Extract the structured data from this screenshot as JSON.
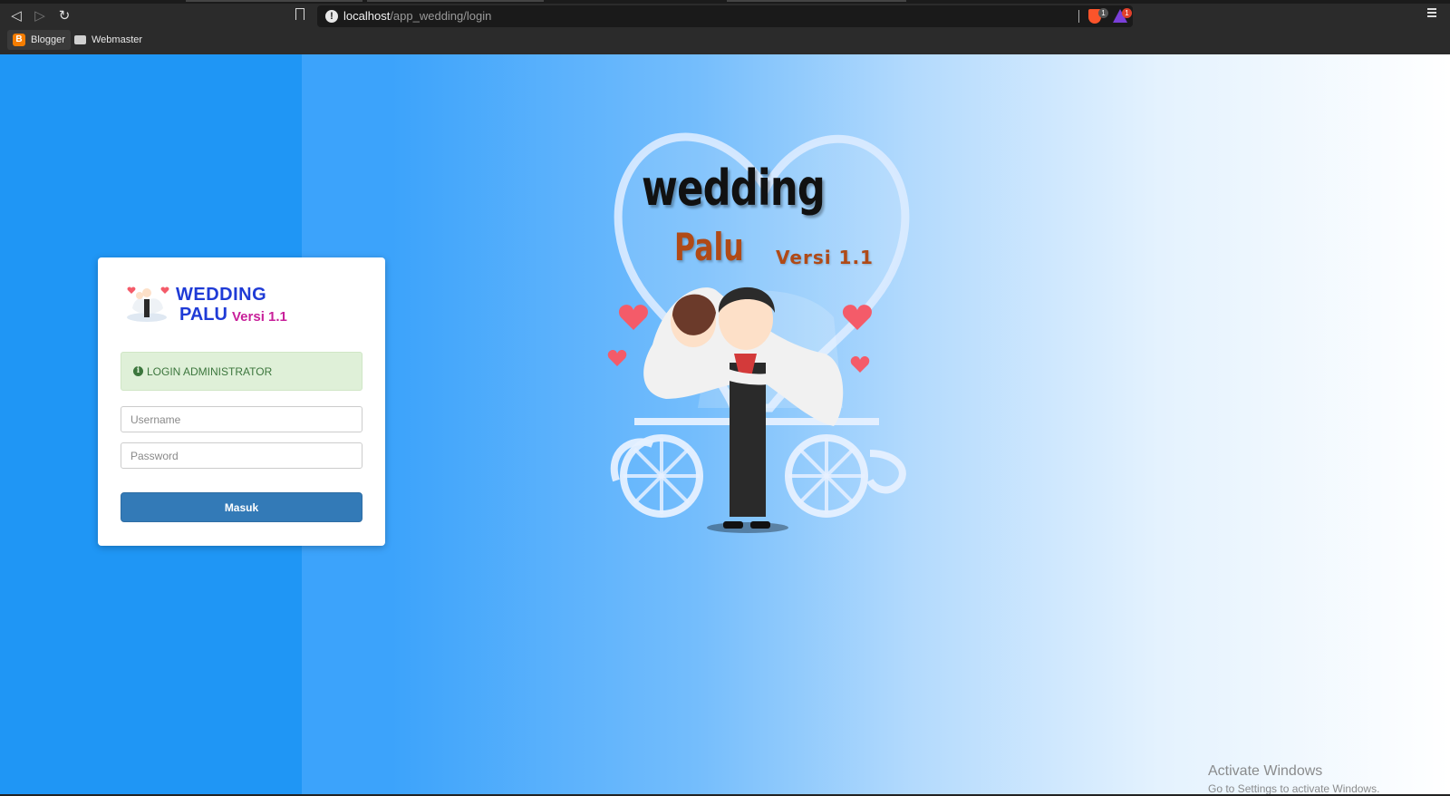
{
  "browser": {
    "url_host": "localhost",
    "url_path": "/app_wedding/login",
    "brave_shield_count": "1",
    "rewards_count": "1",
    "bookmarks": [
      {
        "label": "Blogger"
      },
      {
        "label": "Webmaster"
      }
    ]
  },
  "login_card": {
    "brand_line1": "WEDDING",
    "brand_line2": "PALU",
    "brand_version": "Versi 1.1",
    "alert_text": "LOGIN ADMINISTRATOR",
    "username_placeholder": "Username",
    "password_placeholder": "Password",
    "submit_label": "Masuk"
  },
  "hero": {
    "title": "wedding",
    "subtitle": "Palu",
    "version": "Versi 1.1"
  },
  "watermark": {
    "title": "Activate Windows",
    "subtitle": "Go to Settings to activate Windows."
  },
  "colors": {
    "left_panel": "#1f96f5",
    "primary_button": "#337ab7",
    "alert_bg": "#dff0d8",
    "brand_blue": "#1f3bd6",
    "brand_magenta": "#c8209a"
  }
}
